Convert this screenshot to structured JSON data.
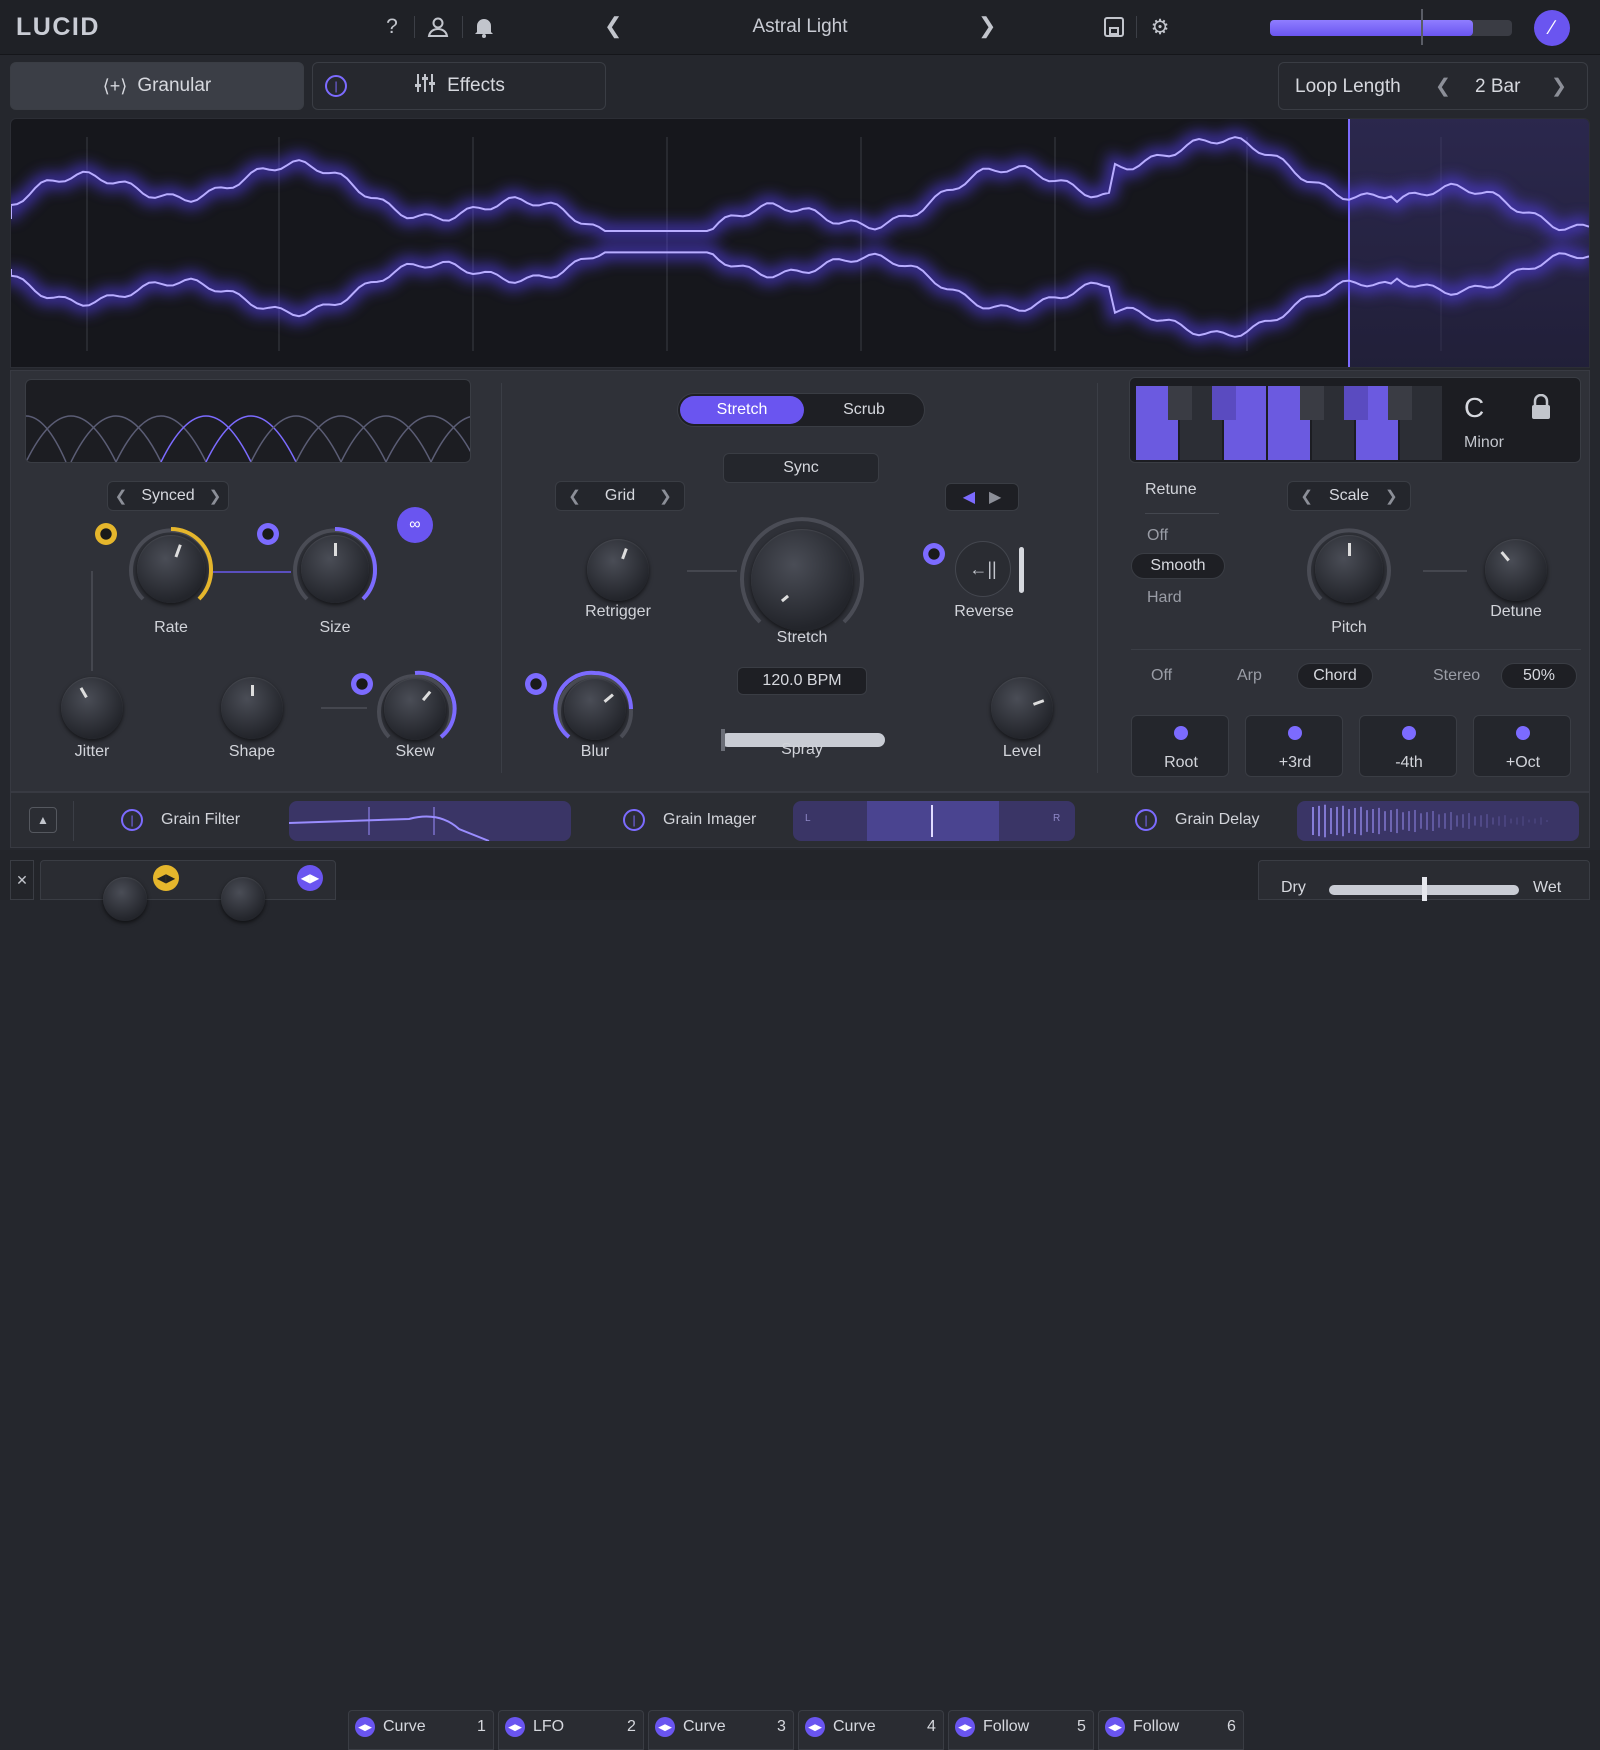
{
  "app": {
    "logo": "LUCID",
    "preset": "Astral Light"
  },
  "topbar": {
    "icons": [
      "help-icon",
      "user-icon",
      "bell-icon",
      "chevron-left-icon",
      "chevron-right-icon",
      "save-icon",
      "gear-icon"
    ],
    "volume": 0.84,
    "accent": "#6a55f0"
  },
  "tabs": {
    "granular": "Granular",
    "effects": "Effects"
  },
  "loop": {
    "label": "Loop Length",
    "value": "2 Bar"
  },
  "left": {
    "sync_mode": "Synced",
    "knobs": {
      "rate": "Rate",
      "size": "Size",
      "jitter": "Jitter",
      "shape": "Shape",
      "skew": "Skew"
    }
  },
  "center": {
    "modes": [
      "Stretch",
      "Scrub"
    ],
    "active_mode": "Stretch",
    "sync": "Sync",
    "grid": "Grid",
    "knobs": {
      "retrigger": "Retrigger",
      "stretch": "Stretch",
      "reverse": "Reverse",
      "blur": "Blur",
      "level": "Level"
    },
    "bpm": "120.0 BPM",
    "spray": "Spray",
    "spray_value": 0.0
  },
  "right": {
    "key": "C",
    "scale_name": "Minor",
    "retune": "Retune",
    "retune_options": [
      "Off",
      "Smooth",
      "Hard"
    ],
    "retune_selected": "Smooth",
    "scale": "Scale",
    "knobs": {
      "pitch": "Pitch",
      "detune": "Detune"
    },
    "modes": [
      "Off",
      "Arp",
      "Chord"
    ],
    "mode_selected": "Chord",
    "stereo": "Stereo",
    "stereo_value": "50%",
    "chord_notes": [
      "Root",
      "+3rd",
      "-4th",
      "+Oct"
    ]
  },
  "fx": {
    "filter": "Grain Filter",
    "imager": "Grain Imager",
    "delay": "Grain Delay",
    "imager_l": "L",
    "imager_r": "R"
  },
  "mod": {
    "slots": [
      {
        "name": "Curve",
        "num": "1"
      },
      {
        "name": "LFO",
        "num": "2"
      },
      {
        "name": "Curve",
        "num": "3"
      },
      {
        "name": "Curve",
        "num": "4"
      },
      {
        "name": "Follow",
        "num": "5"
      },
      {
        "name": "Follow",
        "num": "6"
      }
    ],
    "dry": "Dry",
    "wet": "Wet",
    "mix": 0.5
  }
}
